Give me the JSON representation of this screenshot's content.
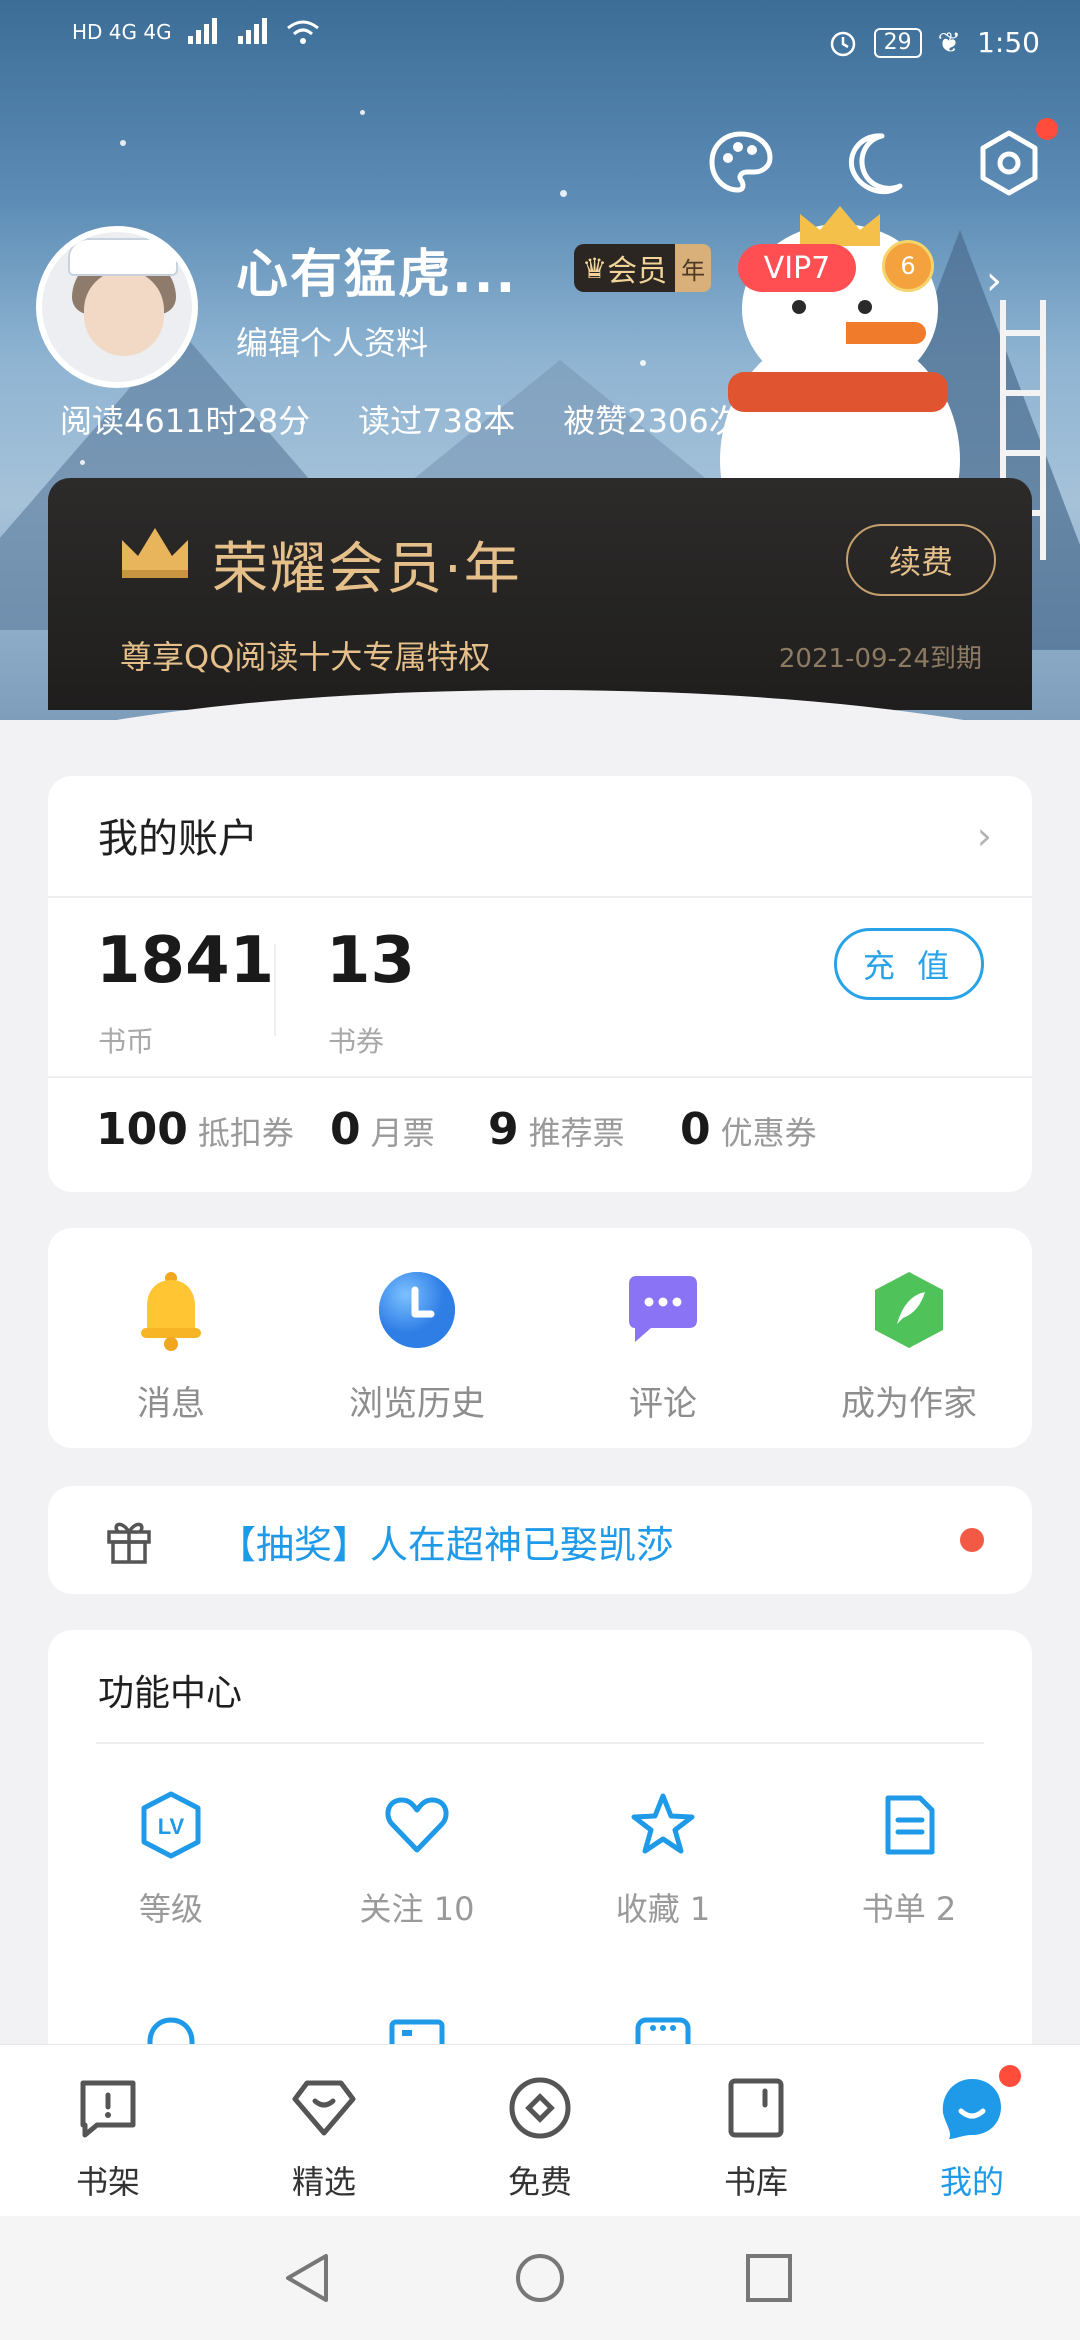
{
  "status_bar": {
    "left_text": "HD 4G 4G",
    "battery": "29",
    "time": "1:50"
  },
  "header": {
    "username": "心有猛虎...",
    "edit_profile": "编辑个人资料",
    "member_badge": "会员",
    "member_badge_year": "年",
    "vip_badge": "VIP7",
    "level_badge": "6",
    "stats": [
      "阅读4611时28分",
      "读过738本",
      "被赞2306次"
    ]
  },
  "member_card": {
    "title": "荣耀会员·年",
    "renew": "续费",
    "desc": "尊享QQ阅读十大专属特权",
    "expire": "2021-09-24到期"
  },
  "account": {
    "title": "我的账户",
    "coins": {
      "value": "1841",
      "label": "书币"
    },
    "vouchers": {
      "value": "13",
      "label": "书券"
    },
    "recharge": "充 值",
    "tickets": [
      {
        "num": "100",
        "label": "抵扣券"
      },
      {
        "num": "0",
        "label": "月票"
      },
      {
        "num": "9",
        "label": "推荐票"
      },
      {
        "num": "0",
        "label": "优惠券"
      }
    ]
  },
  "quick": [
    {
      "label": "消息",
      "icon": "bell-icon",
      "color": "#ffc533"
    },
    {
      "label": "浏览历史",
      "icon": "clock-icon",
      "color": "#3d94f2"
    },
    {
      "label": "评论",
      "icon": "comment-icon",
      "color": "#8a74f5"
    },
    {
      "label": "成为作家",
      "icon": "feather-icon",
      "color": "#4fc25a"
    }
  ],
  "lottery": {
    "text": "【抽奖】人在超神已娶凯莎"
  },
  "functions": {
    "title": "功能中心",
    "items": [
      {
        "label": "等级",
        "icon": "level-icon"
      },
      {
        "label": "关注 10",
        "icon": "heart-icon"
      },
      {
        "label": "收藏 1",
        "icon": "star-icon"
      },
      {
        "label": "书单 2",
        "icon": "booklist-icon"
      }
    ]
  },
  "bottom_nav": [
    {
      "label": "书架",
      "icon": "bookshelf-icon"
    },
    {
      "label": "精选",
      "icon": "featured-icon"
    },
    {
      "label": "免费",
      "icon": "free-icon"
    },
    {
      "label": "书库",
      "icon": "library-icon"
    },
    {
      "label": "我的",
      "icon": "profile-icon",
      "active": true
    }
  ],
  "colors": {
    "accent": "#1f9ae8",
    "gold": "#e6c08a",
    "vip_red": "#ff4f53"
  }
}
